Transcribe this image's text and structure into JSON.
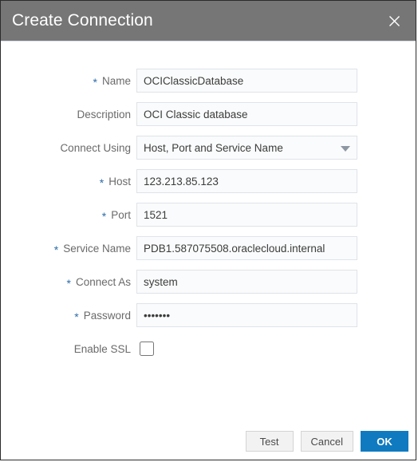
{
  "dialog": {
    "title": "Create Connection",
    "close_icon": "close-icon"
  },
  "form": {
    "fields": [
      {
        "label": "Name",
        "required": true,
        "type": "text",
        "value": "OCIClassicDatabase",
        "placeholder": ""
      },
      {
        "label": "Description",
        "required": false,
        "type": "text",
        "value": "OCI Classic database",
        "placeholder": ""
      },
      {
        "label": "Connect Using",
        "required": false,
        "type": "select",
        "value": "Host, Port and Service Name",
        "placeholder": "",
        "options": [
          "Host, Port and Service Name"
        ],
        "caret_icon": "chevron-down-icon"
      },
      {
        "label": "Host",
        "required": true,
        "type": "text",
        "value": "123.213.85.123",
        "placeholder": ""
      },
      {
        "label": "Port",
        "required": true,
        "type": "text",
        "value": "1521",
        "placeholder": ""
      },
      {
        "label": "Service Name",
        "required": true,
        "type": "text",
        "value": "PDB1.587075508.oraclecloud.internal",
        "placeholder": ""
      },
      {
        "label": "Connect As",
        "required": true,
        "type": "text",
        "value": "system",
        "placeholder": ""
      },
      {
        "label": "Password",
        "required": true,
        "type": "password",
        "value": "1234567",
        "placeholder": ""
      },
      {
        "label": "Enable SSL",
        "required": false,
        "type": "checkbox",
        "checked": false
      }
    ],
    "required_marker": "*"
  },
  "footer": {
    "test_label": "Test",
    "cancel_label": "Cancel",
    "ok_label": "OK"
  },
  "colors": {
    "titlebar_bg": "#767676",
    "primary_button": "#0f7ac0",
    "required_asterisk": "#2d6ca8",
    "label_text": "#6a6a6a",
    "field_border": "#dfe3e8",
    "field_bg": "#fafbfc"
  }
}
